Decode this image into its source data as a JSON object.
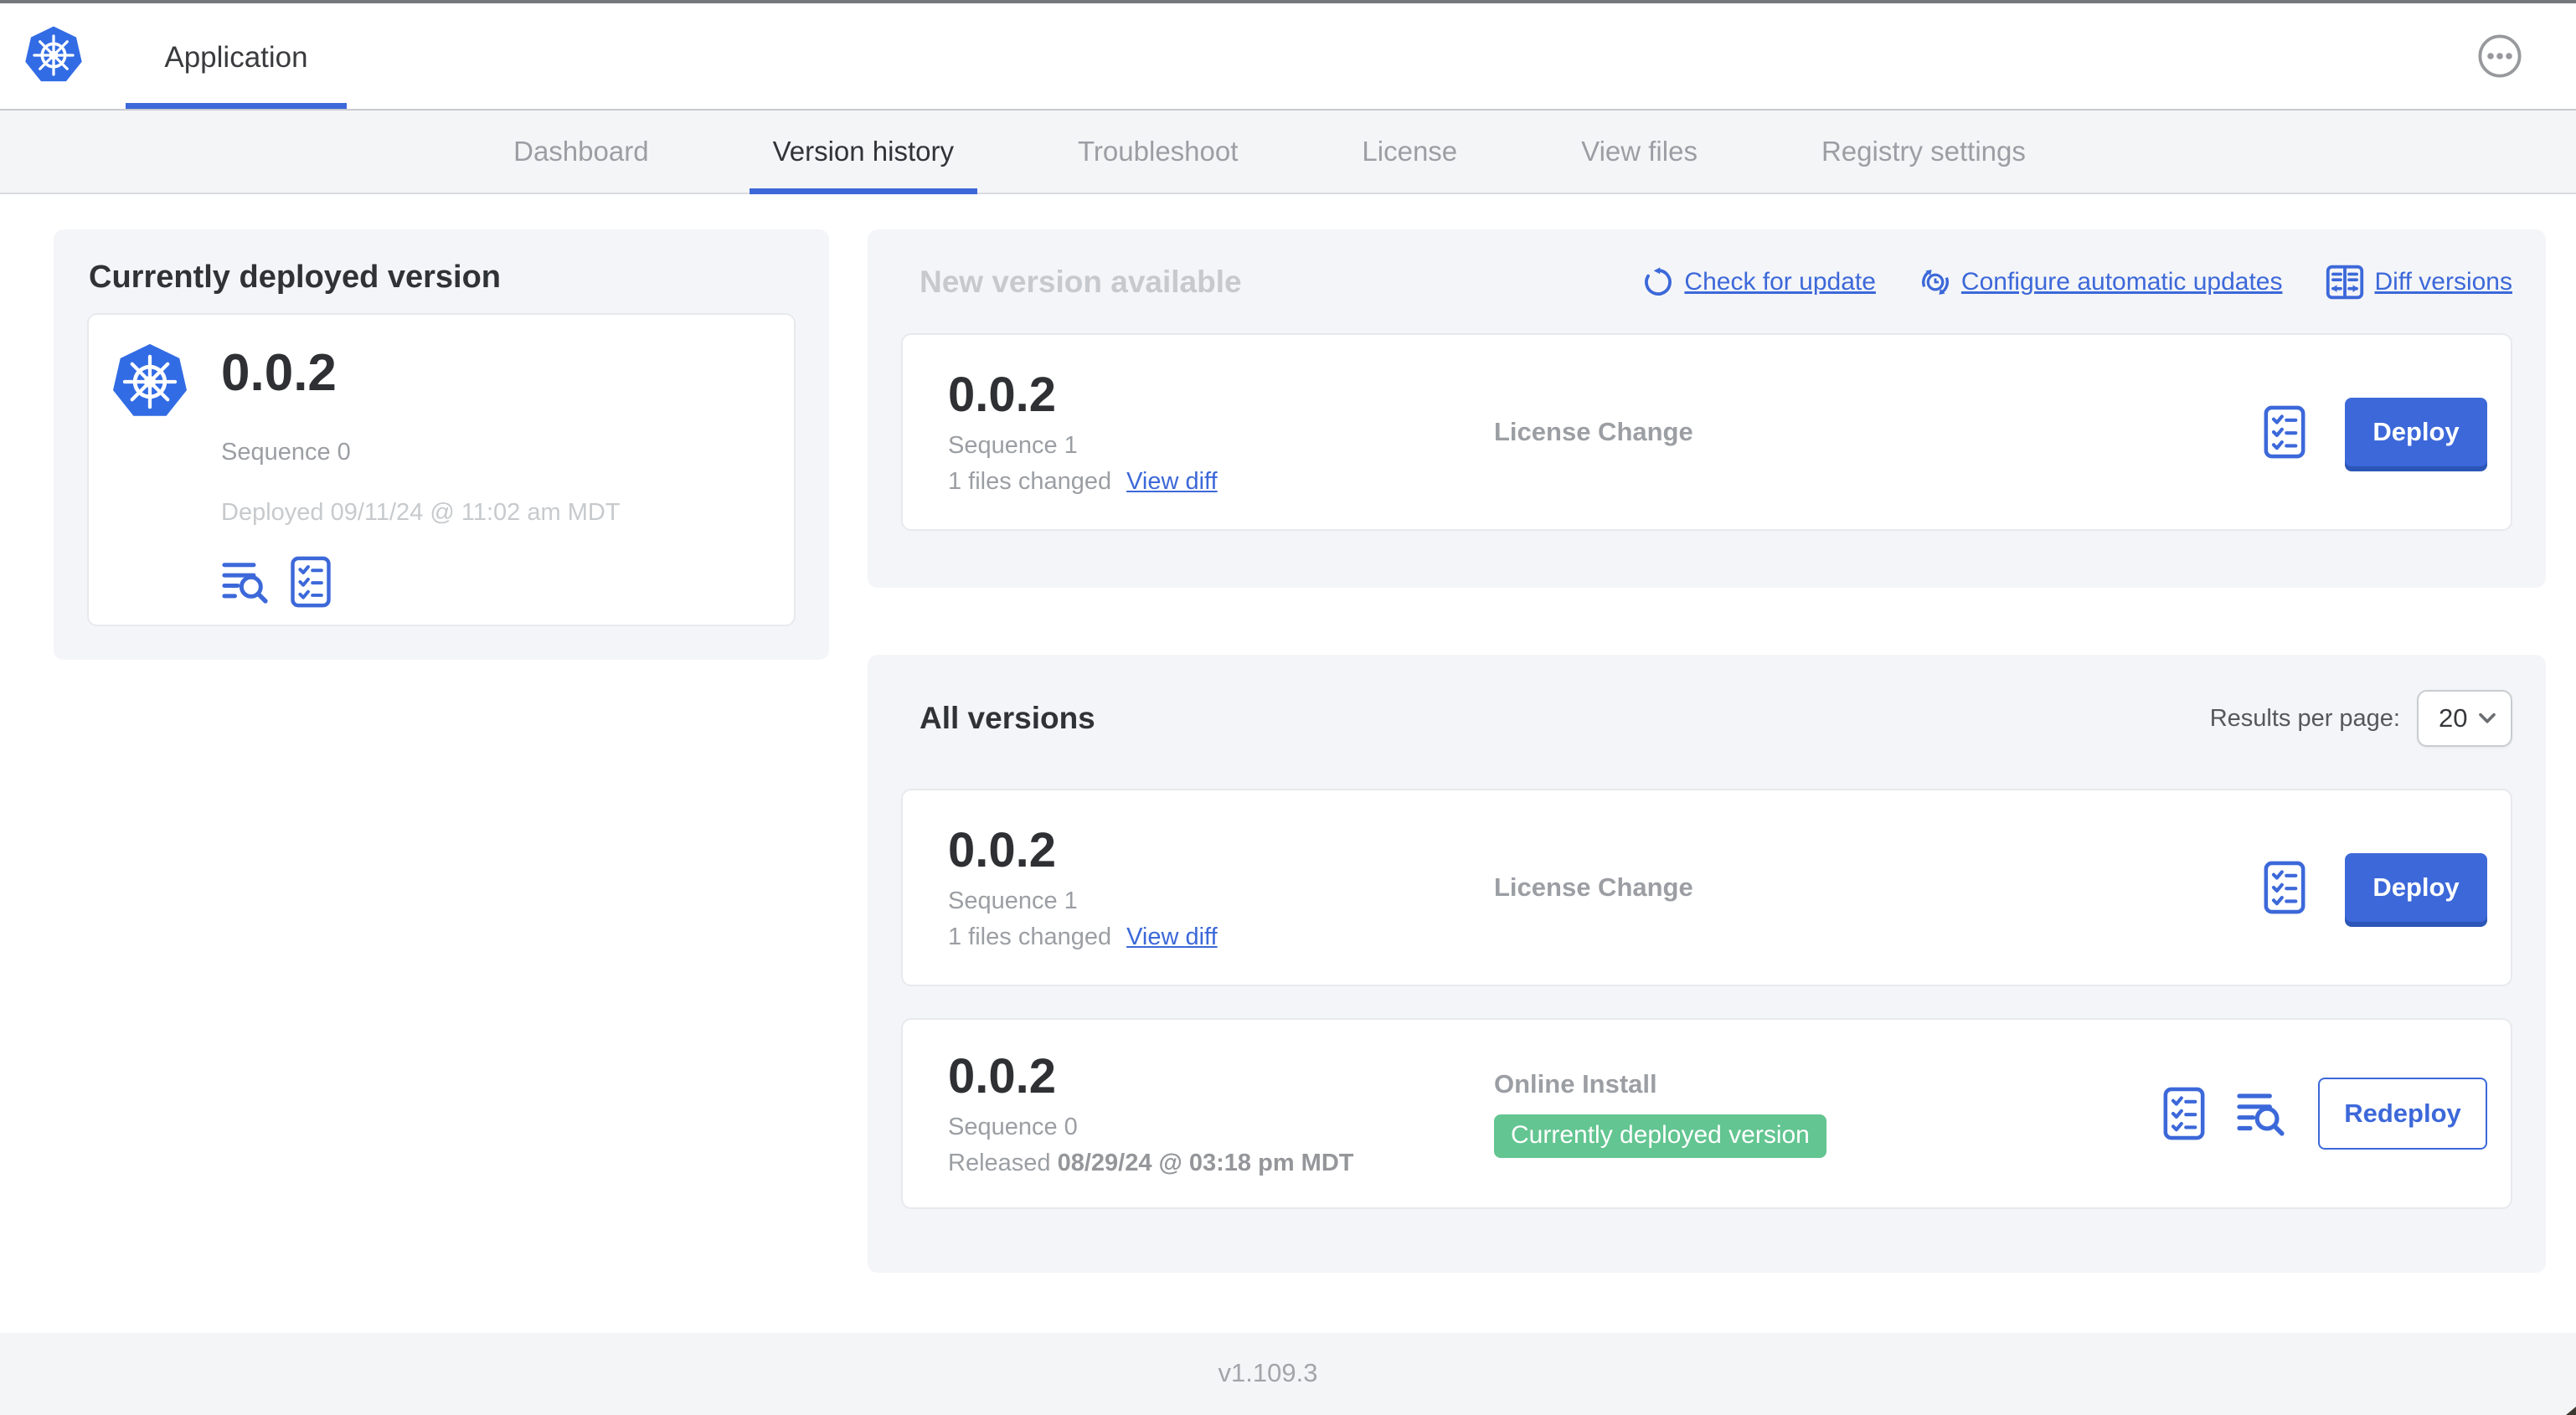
{
  "header": {
    "app_tab_label": "Application"
  },
  "nav_tabs": [
    {
      "label": "Dashboard",
      "active": false
    },
    {
      "label": "Version history",
      "active": true
    },
    {
      "label": "Troubleshoot",
      "active": false
    },
    {
      "label": "License",
      "active": false
    },
    {
      "label": "View files",
      "active": false
    },
    {
      "label": "Registry settings",
      "active": false
    }
  ],
  "currently_deployed": {
    "title": "Currently deployed version",
    "version": "0.0.2",
    "sequence": "Sequence 0",
    "deployed_at": "Deployed 09/11/24 @ 11:02 am MDT"
  },
  "new_version": {
    "title": "New version available",
    "actions": {
      "check_for_update": "Check for update",
      "configure_automatic_updates": "Configure automatic updates",
      "diff_versions": "Diff versions"
    },
    "row": {
      "version": "0.0.2",
      "sequence": "Sequence 1",
      "files_changed": "1 files changed",
      "view_diff": "View diff",
      "source": "License Change",
      "deploy_label": "Deploy"
    }
  },
  "all_versions": {
    "title": "All versions",
    "results_per_page_label": "Results per page:",
    "results_per_page_value": "20",
    "rows": [
      {
        "version": "0.0.2",
        "sequence": "Sequence 1",
        "files_changed": "1 files changed",
        "view_diff": "View diff",
        "source": "License Change",
        "action_label": "Deploy"
      },
      {
        "version": "0.0.2",
        "sequence": "Sequence 0",
        "released_label": "Released",
        "released_date": "08/29/24 @ 03:18 pm MDT",
        "source": "Online Install",
        "badge": "Currently deployed version",
        "action_label": "Redeploy"
      }
    ]
  },
  "footer": {
    "version": "v1.109.3"
  },
  "icons": {
    "app_logo": "kubernetes-helm",
    "more_menu": "ellipsis-circle",
    "check_for_update": "refresh-arrow",
    "configure_automatic_updates": "clock-refresh",
    "diff_versions": "split-diff",
    "release_notes": "lines-magnifier",
    "preflight_checks": "checklist",
    "select_chevron": "chevron-down"
  },
  "colors": {
    "accent_blue": "#3c68d9",
    "logo_blue": "#326ce5",
    "badge_green": "#63c591",
    "panel_bg": "#f4f5f8",
    "footer_bg": "#f4f5f7",
    "text_dark": "#2f3236",
    "text_gray": "#9b9ea3",
    "text_light": "#c7cacd"
  }
}
